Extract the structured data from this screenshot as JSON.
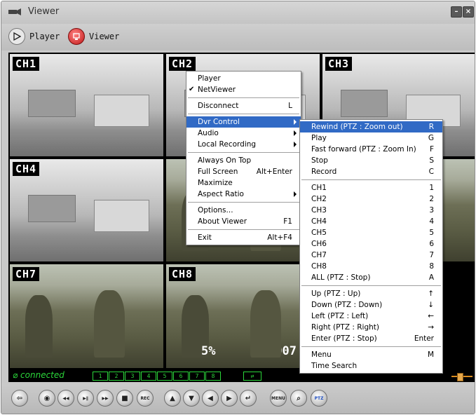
{
  "window": {
    "title": "Viewer",
    "minimize_icon": "minimize-icon",
    "close_icon": "close-icon"
  },
  "mode_tabs": [
    {
      "label": "Player",
      "icon": "player-icon"
    },
    {
      "label": "Viewer",
      "icon": "viewer-icon"
    }
  ],
  "channels": [
    {
      "label": "CH1",
      "scene": "office"
    },
    {
      "label": "CH2",
      "scene": "office"
    },
    {
      "label": "CH3",
      "scene": "office"
    },
    {
      "label": "CH4",
      "scene": "office"
    },
    {
      "label": "CH7",
      "scene": "soldiers"
    },
    {
      "label": "CH8",
      "scene": "soldiers"
    }
  ],
  "overlay": {
    "percent": "5%",
    "year": "2007"
  },
  "status": {
    "connected": "connected",
    "indicators": [
      "1",
      "2",
      "3",
      "4",
      "5",
      "6",
      "7",
      "8"
    ]
  },
  "context_menu": {
    "items": [
      {
        "label": "Player",
        "accel": ""
      },
      {
        "label": "NetViewer",
        "accel": "",
        "checked": true
      },
      {
        "sep": true
      },
      {
        "label": "Disconnect",
        "accel": "L"
      },
      {
        "sep": true
      },
      {
        "label": "Dvr Control",
        "accel": "",
        "submenu": true,
        "highlight": true
      },
      {
        "label": "Audio",
        "accel": "",
        "submenu": true
      },
      {
        "label": "Local Recording",
        "accel": "",
        "submenu": true
      },
      {
        "sep": true
      },
      {
        "label": "Always On Top",
        "accel": ""
      },
      {
        "label": "Full Screen",
        "accel": "Alt+Enter"
      },
      {
        "label": "Maximize",
        "accel": ""
      },
      {
        "label": "Aspect Ratio",
        "accel": "",
        "submenu": true
      },
      {
        "sep": true
      },
      {
        "label": "Options...",
        "accel": ""
      },
      {
        "label": "About Viewer",
        "accel": "F1"
      },
      {
        "sep": true
      },
      {
        "label": "Exit",
        "accel": "Alt+F4"
      }
    ]
  },
  "dvr_submenu": {
    "items": [
      {
        "label": "Rewind (PTZ : Zoom out)",
        "accel": "R",
        "highlight": true
      },
      {
        "label": "Play",
        "accel": "G"
      },
      {
        "label": "Fast forward (PTZ : Zoom In)",
        "accel": "F"
      },
      {
        "label": "Stop",
        "accel": "S"
      },
      {
        "label": "Record",
        "accel": "C"
      },
      {
        "sep": true
      },
      {
        "label": "CH1",
        "accel": "1"
      },
      {
        "label": "CH2",
        "accel": "2"
      },
      {
        "label": "CH3",
        "accel": "3"
      },
      {
        "label": "CH4",
        "accel": "4"
      },
      {
        "label": "CH5",
        "accel": "5"
      },
      {
        "label": "CH6",
        "accel": "6"
      },
      {
        "label": "CH7",
        "accel": "7"
      },
      {
        "label": "CH8",
        "accel": "8"
      },
      {
        "label": "ALL (PTZ : Stop)",
        "accel": "A"
      },
      {
        "sep": true
      },
      {
        "label": "Up (PTZ : Up)",
        "accel": "↑"
      },
      {
        "label": "Down (PTZ : Down)",
        "accel": "↓"
      },
      {
        "label": "Left (PTZ : Left)",
        "accel": "←"
      },
      {
        "label": "Right (PTZ : Right)",
        "accel": "→"
      },
      {
        "label": "Enter (PTZ : Stop)",
        "accel": "Enter"
      },
      {
        "sep": true
      },
      {
        "label": "Menu",
        "accel": "M"
      },
      {
        "label": "Time Search",
        "accel": ""
      }
    ]
  },
  "controls": [
    {
      "name": "exit-button",
      "glyph": "⇦"
    },
    {
      "name": "camera-button",
      "glyph": "◉"
    },
    {
      "name": "rewind-button",
      "glyph": "◀◀"
    },
    {
      "name": "play-pause-button",
      "glyph": "▶∥"
    },
    {
      "name": "fast-forward-button",
      "glyph": "▶▶"
    },
    {
      "name": "stop-button",
      "glyph": "■"
    },
    {
      "name": "record-button",
      "glyph": "REC"
    },
    {
      "name": "up-button",
      "glyph": "▲"
    },
    {
      "name": "down-button",
      "glyph": "▼"
    },
    {
      "name": "left-button",
      "glyph": "◀"
    },
    {
      "name": "right-button",
      "glyph": "▶"
    },
    {
      "name": "enter-button",
      "glyph": "↵"
    },
    {
      "name": "menu-button",
      "glyph": "MENU"
    },
    {
      "name": "search-button",
      "glyph": "⌕"
    },
    {
      "name": "ptz-button",
      "glyph": "PTZ"
    }
  ]
}
